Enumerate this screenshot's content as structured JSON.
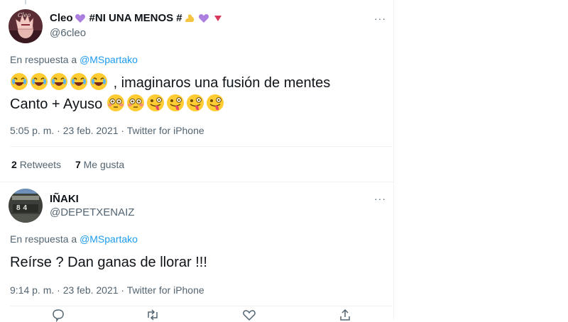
{
  "tweet1": {
    "display_name": "Cleo",
    "name_suffix": "#NI UNA MENOS #",
    "handle": "@6cleo",
    "avatar_caption": "Cleo",
    "reply_prefix": "En respuesta a",
    "reply_to": "@MSpartako",
    "text_line1": ", imaginaros una fusión de mentes",
    "text_line2": "Canto + Ayuso",
    "timestamp": "5:05 p. m. · 23 feb. 2021 · Twitter for iPhone",
    "retweets_count": "2",
    "retweets_label": "Retweets",
    "likes_count": "7",
    "likes_label": "Me gusta",
    "more_label": "···"
  },
  "tweet2": {
    "display_name": "IÑAKI",
    "handle": "@DEPETXENAIZ",
    "avatar_number": "84",
    "reply_prefix": "En respuesta a",
    "reply_to": "@MSpartako",
    "text": "Reírse ? Dan ganas de llorar !!!",
    "timestamp": "9:14 p. m. · 23 feb. 2021 · Twitter for iPhone",
    "more_label": "···"
  },
  "colors": {
    "accent": "#1d9bf0",
    "secondary_text": "#536471",
    "divider": "#eff3f4"
  },
  "icons": [
    "heart-icon",
    "flexed-bicep-icon",
    "triangle-icon",
    "laughing-emoji",
    "flushed-emoji",
    "zany-face-emoji",
    "more-icon",
    "reply-icon",
    "retweet-icon",
    "like-icon",
    "share-icon"
  ]
}
